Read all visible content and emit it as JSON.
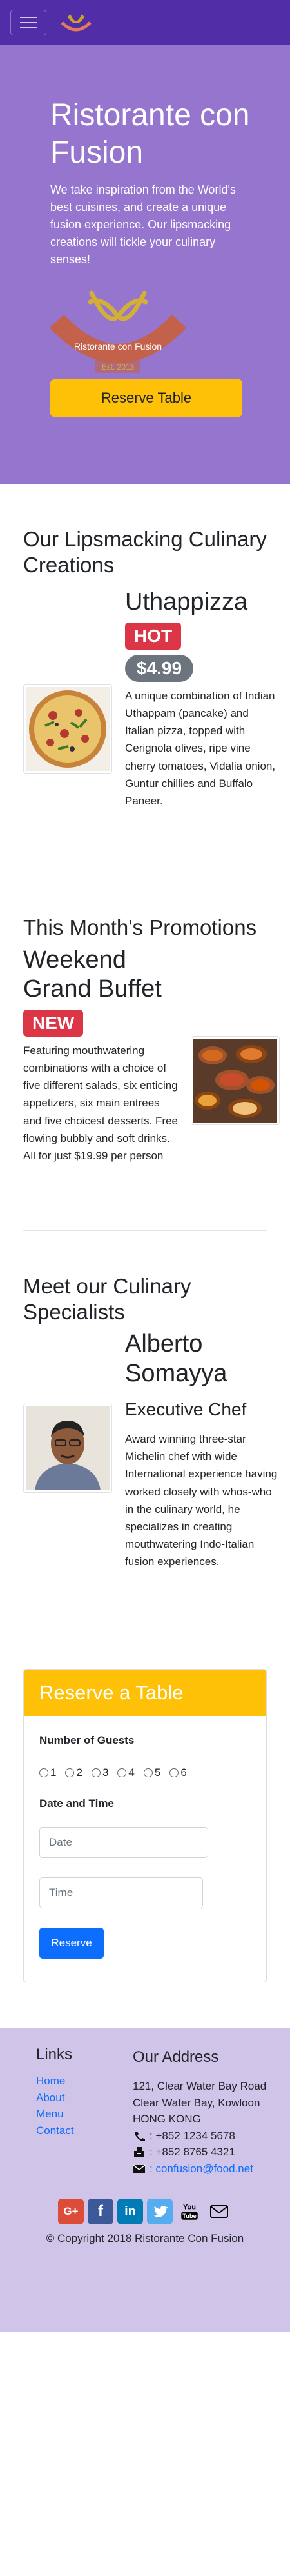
{
  "colors": {
    "primary_dark": "#512DA8",
    "primary": "#9575CD",
    "primary_light": "#D1C4E9",
    "accent": "#FFC107",
    "danger": "#dc3545",
    "link": "#0d6efd"
  },
  "navbar": {
    "toggler_icon": "hamburger-icon",
    "logo_icon": "restaurant-logo"
  },
  "hero": {
    "title": "Ristorante con Fusion",
    "description": "We take inspiration from the World's best cuisines, and create a unique fusion experience. Our lipsmacking creations will tickle your culinary senses!",
    "logo_text": "Ristorante con Fusion",
    "logo_year": "Est. 2013",
    "button": "Reserve Table"
  },
  "dish": {
    "section_title": "Our Lipsmacking Culinary Creations",
    "name": "Uthappizza",
    "badge": "HOT",
    "price": "$4.99",
    "description": "A unique combination of Indian Uthappam (pancake) and Italian pizza, topped with Cerignola olives, ripe vine cherry tomatoes, Vidalia onion, Guntur chillies and Buffalo Paneer."
  },
  "promotion": {
    "section_title": "This Month's Promotions",
    "name": "Weekend Grand Buffet",
    "badge": "NEW",
    "description": "Featuring mouthwatering combinations with a choice of five different salads, six enticing appetizers, six main entrees and five choicest desserts. Free flowing bubbly and soft drinks. All for just $19.99 per person"
  },
  "leader": {
    "section_title": "Meet our Culinary Specialists",
    "name": "Alberto Somayya",
    "designation": "Executive Chef",
    "description": "Award winning three-star Michelin chef with wide International experience having worked closely with whos-who in the culinary world, he specializes in creating mouthwatering Indo-Italian fusion experiences."
  },
  "reservation": {
    "title": "Reserve a Table",
    "guests_label": "Number of Guests",
    "guest_options": [
      "1",
      "2",
      "3",
      "4",
      "5",
      "6"
    ],
    "datetime_label": "Date and Time",
    "date_placeholder": "Date",
    "time_placeholder": "Time",
    "submit": "Reserve"
  },
  "footer": {
    "links_title": "Links",
    "links": [
      "Home",
      "About",
      "Menu",
      "Contact"
    ],
    "address_title": "Our Address",
    "address": [
      "121, Clear Water Bay Road",
      "Clear Water Bay, Kowloon",
      "HONG KONG"
    ],
    "phone": ": +852 1234 5678",
    "fax": ": +852 8765 4321",
    "email": ": confusion@food.net",
    "social": [
      "google-plus-icon",
      "facebook-icon",
      "linkedin-icon",
      "twitter-icon",
      "youtube-icon",
      "mail-icon"
    ],
    "copyright": "© Copyright 2018 Ristorante Con Fusion"
  }
}
